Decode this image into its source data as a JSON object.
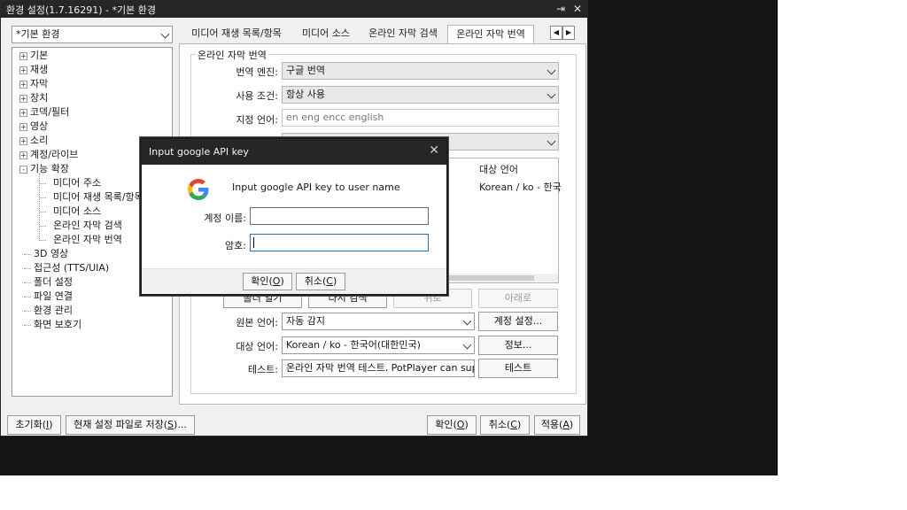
{
  "window": {
    "title": "환경 설정(1.7.16291) - *기본 환경",
    "pin_icon": "pin-icon",
    "close_icon": "close-icon"
  },
  "profile": {
    "selected": "*기본 환경"
  },
  "tree": {
    "top_items": [
      "기본",
      "재생",
      "자막",
      "장치",
      "코덱/필터",
      "영상",
      "소리",
      "계정/라이브"
    ],
    "expanded_item": "기능 확장",
    "children": [
      "미디어 주소",
      "미디어 재생 목록/항목",
      "미디어 소스",
      "온라인 자막 검색",
      "온라인 자막 번역"
    ],
    "bottom_items": [
      "3D 영상",
      "접근성 (TTS/UIA)",
      "폴더 설정",
      "파일 연결",
      "환경 관리",
      "화면 보호기"
    ]
  },
  "tabs": [
    "미디어 재생 목록/항목",
    "미디어 소스",
    "온라인 자막 검색",
    "온라인 자막 번역"
  ],
  "active_tab_index": 3,
  "group": {
    "title": "온라인 자막 번역",
    "engine_label": "번역 엔진:",
    "engine_value": "구글 번역",
    "condition_label": "사용 조건:",
    "condition_value": "항상 사용",
    "lang_label": "지정 언어:",
    "lang_value": "en eng encc english",
    "list_header_target": "대상 언어",
    "list_row_target": "Korean / ko - 한국",
    "btn_open": "폴더 열기",
    "btn_research": "다시 검색",
    "btn_up": "위로",
    "btn_down": "아래로",
    "source_label": "원본 언어:",
    "source_value": "자동 감지",
    "account_button": "계정 설정...",
    "target_label": "대상 언어:",
    "target_value": "Korean / ko - 한국어(대한민국)",
    "info_button": "정보...",
    "test_label": "테스트:",
    "test_value": "온라인 자막 번역 테스트. PotPlayer can supp",
    "test_button": "테스트"
  },
  "bottom": {
    "reset_prefix": "초기화(",
    "reset_key": "I",
    "reset_suffix": ")",
    "save_prefix": "현재 설정 파일로 저장(",
    "save_key": "S",
    "save_suffix": ")...",
    "ok_prefix": "확인(",
    "ok_key": "O",
    "ok_suffix": ")",
    "cancel_prefix": "취소(",
    "cancel_key": "C",
    "cancel_suffix": ")",
    "apply_prefix": "적용(",
    "apply_key": "A",
    "apply_suffix": ")"
  },
  "dialog": {
    "title": "Input google API key",
    "message": "Input google API key to user name",
    "account_label": "계정 이름:",
    "account_value": "",
    "password_label": "암호:",
    "password_value": "",
    "ok_prefix": "확인(",
    "ok_key": "O",
    "ok_suffix": ")",
    "cancel_prefix": "취소(",
    "cancel_key": "C",
    "cancel_suffix": ")",
    "logo_icon": "google-logo-icon"
  },
  "colors": {
    "titlebar": "#262626",
    "google_blue": "#4285F4",
    "google_red": "#EA4335",
    "google_yellow": "#FBBC05",
    "google_green": "#34A853"
  }
}
